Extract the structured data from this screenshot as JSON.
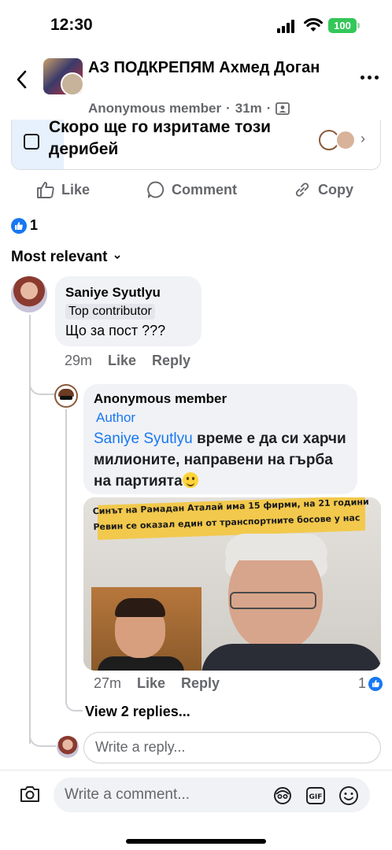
{
  "status_bar": {
    "time": "12:30",
    "battery": "100"
  },
  "header": {
    "group_name": "АЗ ПОДКРЕПЯМ Ахмед Доган",
    "author": "Anonymous member",
    "time": "31m",
    "icons": [
      "back-chevron-icon",
      "more-icon",
      "audience-icon"
    ]
  },
  "poll": {
    "option_text": "Скоро ще го изритаме този дерибей"
  },
  "post_actions": {
    "like": "Like",
    "comment": "Comment",
    "copy": "Copy"
  },
  "reactions": {
    "count": "1"
  },
  "sort": {
    "label": "Most relevant"
  },
  "comments": [
    {
      "author": "Saniye Syutlyu",
      "badge": "Top contributor",
      "text": "Що за пост ???",
      "time": "29m",
      "like": "Like",
      "reply": "Reply"
    }
  ],
  "reply": {
    "author": "Anonymous member",
    "badge": "Author",
    "mention": "Saniye Syutlyu",
    "text": " време е да си харчи милионите, направени на гърба на партията",
    "image_headline": "Синът на Рамадан Аталай има 15 фирми, на 21 години Ревин се оказал един от транспортните босове у нас",
    "time": "27m",
    "like": "Like",
    "reply": "Reply",
    "likes_count": "1",
    "view_replies": "View 2 replies..."
  },
  "reply_box": {
    "placeholder": "Write a reply..."
  },
  "comment_box": {
    "placeholder": "Write a comment..."
  },
  "colors": {
    "accent": "#1877f2",
    "bubble": "#f0f2f5",
    "muted": "#65676b",
    "battery": "#34c759"
  }
}
